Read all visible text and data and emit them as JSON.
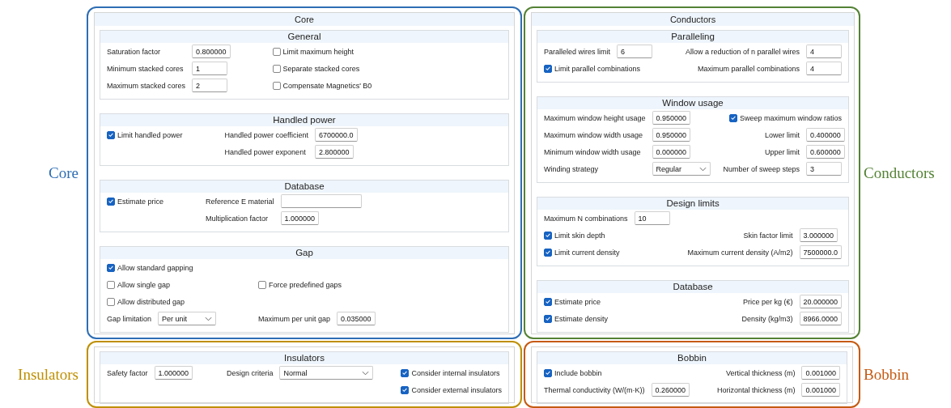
{
  "panels": [
    {
      "caption": "Core",
      "color": "#2e6db4",
      "title": "Core",
      "sections": [
        {
          "title": "General",
          "rows": [
            {
              "left": {
                "kind": "field",
                "label": "Saturation factor",
                "value": "0.800000"
              },
              "right": {
                "kind": "checkbox",
                "label": "Limit maximum height",
                "checked": false
              }
            },
            {
              "left": {
                "kind": "field",
                "label": "Minimum stacked cores",
                "value": "1"
              },
              "right": {
                "kind": "checkbox",
                "label": "Separate stacked cores",
                "checked": false
              }
            },
            {
              "left": {
                "kind": "field",
                "label": "Maximum stacked cores",
                "value": "2"
              },
              "right": {
                "kind": "checkbox",
                "label": "Compensate Magnetics' B0",
                "checked": false
              }
            }
          ]
        },
        {
          "title": "Handled power",
          "rows": [
            {
              "left": {
                "kind": "checkbox",
                "label": "Limit handled power",
                "checked": true
              },
              "right": {
                "kind": "field",
                "label": "Handled power coefficient",
                "value": "6700000.0"
              }
            },
            {
              "right": {
                "kind": "field",
                "label": "Handled power exponent",
                "value": "2.800000"
              }
            }
          ]
        },
        {
          "title": "Database",
          "rows": [
            {
              "left": {
                "kind": "checkbox",
                "label": "Estimate price",
                "checked": true
              },
              "right": {
                "kind": "field",
                "label": "Reference E material"
              }
            },
            {
              "right": {
                "kind": "field",
                "label": "Multiplication factor",
                "value": "1.000000"
              }
            }
          ]
        },
        {
          "title": "Gap",
          "rows": [
            {
              "left": {
                "kind": "checkbox",
                "label": "Allow standard gapping",
                "checked": true
              }
            },
            {
              "left": {
                "kind": "checkbox",
                "label": "Allow single gap",
                "checked": false
              },
              "right": {
                "kind": "checkbox",
                "label": "Force predefined gaps",
                "checked": false
              }
            },
            {
              "left": {
                "kind": "checkbox",
                "label": "Allow distributed gap",
                "checked": false
              }
            },
            {
              "left": {
                "kind": "select",
                "label": "Gap limitation",
                "value": "Per unit"
              },
              "right": {
                "kind": "field",
                "label": "Maximum per unit gap",
                "value": "0.035000"
              }
            }
          ]
        }
      ]
    },
    {
      "caption": "Conductors",
      "color": "#548235",
      "title": "Conductors",
      "sections": [
        {
          "title": "Paralleling",
          "rows": [
            {
              "left": {
                "kind": "field",
                "label": "Paralleled wires limit",
                "value": "6"
              },
              "right": {
                "kind": "field",
                "label": "Allow a reduction of n parallel wires",
                "value": "4"
              }
            },
            {
              "left": {
                "kind": "checkbox",
                "label": "Limit parallel combinations",
                "checked": true
              },
              "right": {
                "kind": "field",
                "label": "Maximum parallel combinations",
                "value": "4"
              }
            }
          ]
        },
        {
          "title": "Window usage",
          "rows": [
            {
              "left": {
                "kind": "field",
                "label": "Maximum window height usage",
                "value": "0.950000"
              },
              "right": {
                "kind": "checkbox",
                "label": "Sweep maximum window ratios",
                "checked": true
              }
            },
            {
              "left": {
                "kind": "field",
                "label": "Maximum window width usage",
                "value": "0.950000"
              },
              "right": {
                "kind": "field",
                "label": "Lower limit",
                "value": "0.400000"
              }
            },
            {
              "left": {
                "kind": "field",
                "label": "Minimum window width usage",
                "value": "0.000000"
              },
              "right": {
                "kind": "field",
                "label": "Upper limit",
                "value": "0.600000"
              }
            },
            {
              "left": {
                "kind": "select",
                "label": "Winding strategy",
                "value": "Regular"
              },
              "right": {
                "kind": "field",
                "label": "Number of sweep steps",
                "value": "3"
              }
            }
          ]
        },
        {
          "title": "Design limits",
          "rows": [
            {
              "left": {
                "kind": "field",
                "label": "Maximum N combinations",
                "value": "10"
              }
            },
            {
              "left": {
                "kind": "checkbox",
                "label": "Limit skin depth",
                "checked": true
              },
              "right": {
                "kind": "field",
                "label": "Skin factor limit",
                "value": "3.000000"
              }
            },
            {
              "left": {
                "kind": "checkbox",
                "label": "Limit current density",
                "checked": true
              },
              "right": {
                "kind": "field",
                "label": "Maximum current density (A/m2)",
                "value": "7500000.0"
              }
            }
          ]
        },
        {
          "title": "Database",
          "rows": [
            {
              "left": {
                "kind": "checkbox",
                "label": "Estimate price",
                "checked": true
              },
              "right": {
                "kind": "field",
                "label": "Price per kg (€)",
                "value": "20.000000"
              }
            },
            {
              "left": {
                "kind": "checkbox",
                "label": "Estimate density",
                "checked": true
              },
              "right": {
                "kind": "field",
                "label": "Density (kg/m3)",
                "value": "8966.0000"
              }
            }
          ]
        }
      ]
    },
    {
      "caption": "Insulators",
      "color": "#bf8f00",
      "sections": [
        {
          "title": "Insulators",
          "rows": [
            {
              "left": {
                "kind": "field",
                "label": "Safety factor",
                "value": "1.000000"
              },
              "middle": {
                "kind": "select",
                "label": "Design criteria",
                "value": "Normal"
              },
              "right": {
                "kind": "checkbox",
                "label": "Consider internal insulators",
                "checked": true
              }
            },
            {
              "right": {
                "kind": "checkbox",
                "label": "Consider external insulators",
                "checked": true
              }
            }
          ]
        }
      ]
    },
    {
      "caption": "Bobbin",
      "color": "#c55a11",
      "sections": [
        {
          "title": "Bobbin",
          "rows": [
            {
              "left": {
                "kind": "checkbox",
                "label": "Include bobbin",
                "checked": true
              },
              "right": {
                "kind": "field",
                "label": "Vertical thickness (m)",
                "value": "0.001000"
              }
            },
            {
              "left": {
                "kind": "field",
                "label": "Thermal conductivity (W/(m·K))",
                "value": "0.260000"
              },
              "right": {
                "kind": "field",
                "label": "Horizontal thickness (m)",
                "value": "0.001000"
              }
            }
          ]
        }
      ]
    }
  ]
}
